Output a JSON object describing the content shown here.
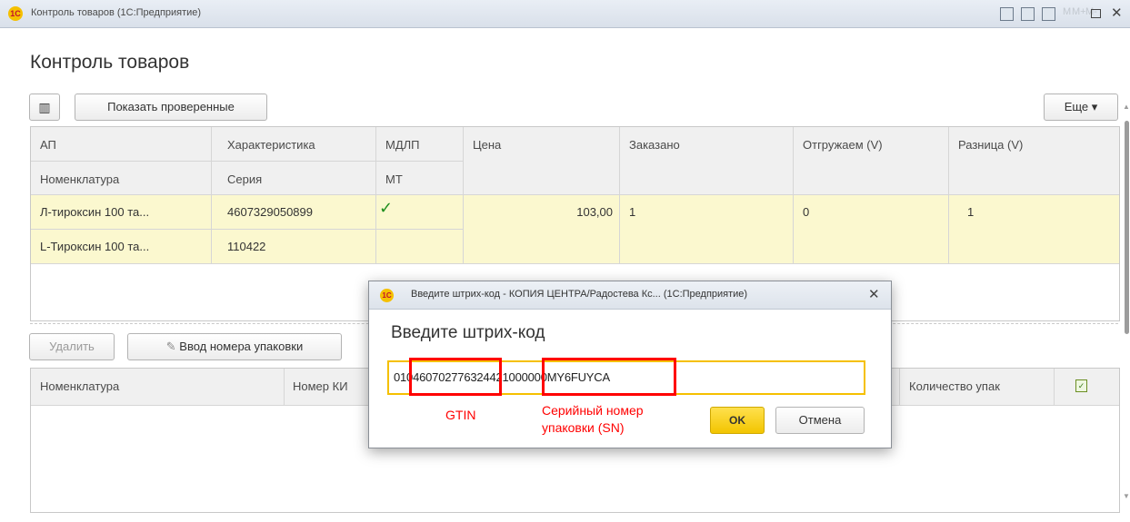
{
  "window": {
    "app_logo": "1С",
    "title": "Контроль товаров  (1С:Предприятие)",
    "faint_buttons": [
      "M",
      "M+",
      "M-"
    ]
  },
  "page": {
    "title": "Контроль товаров"
  },
  "toolbar": {
    "barcode_icon": "barcode-scanner-icon",
    "show_checked_label": "Показать проверенные",
    "more_label": "Еще ▾"
  },
  "top_table": {
    "headers_row1": [
      "АП",
      "Характеристика",
      "МДЛП",
      "Цена",
      "Заказано",
      "Отгружаем (V)",
      "Разница (V)"
    ],
    "headers_row2": [
      "Номенклатура",
      "Серия",
      "МТ"
    ],
    "rows": [
      {
        "ap": "Л-тироксин 100 та...",
        "characteristic": "4607329050899",
        "mdlp": true,
        "price": "103,00",
        "ordered": "1",
        "shipping": "0",
        "difference": "1",
        "nomenclature": "L-Тироксин 100 та...",
        "series": "110422"
      }
    ]
  },
  "bottom_toolbar": {
    "delete_label": "Удалить",
    "package_entry_label": "Ввод номера упаковки"
  },
  "bottom_table": {
    "headers": [
      "Номенклатура",
      "Номер КИ",
      "Количество упак"
    ]
  },
  "dialog": {
    "app_logo": "1С",
    "window_title": "Введите штрих-код - КОПИЯ ЦЕНТРА/Радостева Кс...  (1С:Предприятие)",
    "heading": "Введите штрих-код",
    "barcode_value": "010460702776324421000000MY6FUYCA",
    "gtin_label": "GTIN",
    "sn_label": "Серийный номер упаковки (SN)",
    "ok_label": "OK",
    "cancel_label": "Отмена"
  },
  "colors": {
    "highlight_row": "#fbf8cf",
    "annotation_red": "#ff0000",
    "ok_yellow": "#f2c500",
    "check_green": "#1f8f1f"
  }
}
